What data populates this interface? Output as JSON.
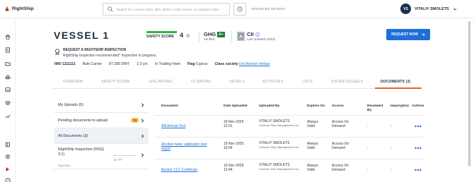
{
  "app": {
    "name": "RightShip"
  },
  "search": {
    "placeholder": "Search for a vessel name, IMO, MMSI or ENI number, or company name",
    "advanced_label": "ADVANCED SEARCH"
  },
  "user": {
    "initials": "VS",
    "name": "VITALIY SMOLETS"
  },
  "vessel": {
    "name": "VESSEL 1",
    "safety": {
      "label": "SAFETY SCORE",
      "score": "4",
      "max": "/5"
    },
    "ghg": {
      "label": "GHG",
      "rating": "A+",
      "sub": "Verified"
    },
    "cii": {
      "label": "CII",
      "sub": "Last updated (2023)"
    },
    "request_button": "REQUEST NOW",
    "inspection_title": "REQUEST A RIGHTSHIP INSPECTION",
    "inspection_sub": "RightShip Inspection recommended* Inspection in progress"
  },
  "facts": {
    "imo": "IMO 1111111",
    "type": "Bulk Carrier",
    "dwt": "87,285 DWT",
    "age": "2.3 y/o",
    "status": "In Trading Fleet",
    "flag_label": "Flag",
    "flag_value": "Cyprus",
    "class_label": "Class society",
    "class_value": "Det Norske Veritas"
  },
  "tabs": [
    "OVERVIEW",
    "SAFETY SCORE",
    "GHG RATING",
    "CII RATING",
    "DETAILS",
    "ACTIVITIES",
    "LISTS",
    "SISTER VESSELS",
    "DOCUMENTS (3)"
  ],
  "left_panel": {
    "my_uploads": "My Uploads (0)",
    "pending": "Pending documents to upload",
    "pending_count": "74",
    "all_docs": "All Documents (3)",
    "rightship": "RightShip Inspection (RISQ 3.1)",
    "rightship_sub": "RightShip",
    "progress_text": "3 / 77",
    "progress_value": 0.04
  },
  "table": {
    "headers": [
      "Document",
      "Date Uploaded",
      "Uploaded By",
      "Expires On",
      "Access",
      "Reviewed By",
      "Inquiry(ies)",
      "Actions"
    ],
    "rows": [
      {
        "doc": "Afli Annual Test",
        "date": "19 Nov 2025",
        "time": "12:01",
        "by": "VITALIY SMOLETS",
        "company": "Centrum Ship Management Ltd.",
        "expires": "Always Valid",
        "access": "Access On Demand",
        "reviewed": "-",
        "inquiry": "-"
      },
      {
        "doc": "Alcohol meter calibration test report",
        "date": "19 Nov 2025",
        "time": "16:04",
        "by": "VITALIY SMOLETS",
        "company": "Centrum Ship Management Ltd.",
        "expires": "Always Valid",
        "access": "Access On Demand",
        "reviewed": "-",
        "inquiry": "-"
      },
      {
        "doc": "Bunker CLC Certificate",
        "date": "19 Nov 2025",
        "time": "12:04",
        "by": "VITALIY SMOLETS",
        "company": "Centrum Ship Management Ltd.",
        "expires": "Always Valid",
        "access": "Access On Demand",
        "reviewed": "-",
        "inquiry": "-"
      }
    ]
  },
  "colors": {
    "accent": "#1e6fd9",
    "active_tab": "#e2632b",
    "safety_bar": "#2fb34a",
    "ghg_badge": "#1f7a3a",
    "navy": "#17324d"
  }
}
